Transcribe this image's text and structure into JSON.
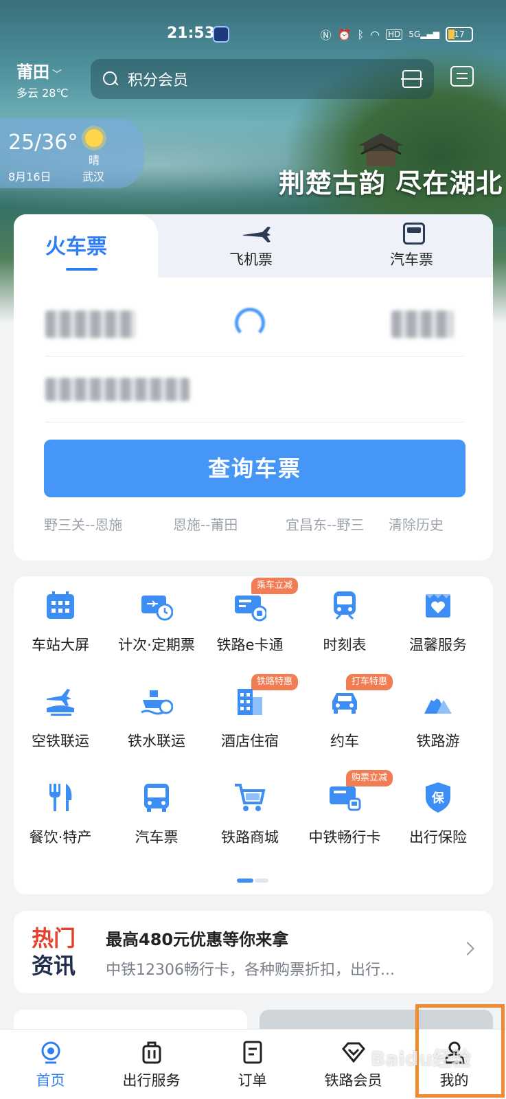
{
  "status_bar": {
    "time": "21:53",
    "hd_label": "HD",
    "signal_label": "5G",
    "battery_label": "17"
  },
  "header": {
    "city": "莆田",
    "weather": "多云 28℃",
    "search_placeholder": "积分会员"
  },
  "weather_card": {
    "temp_range": "25/36°",
    "condition": "晴",
    "date": "8月16日",
    "city": "武汉"
  },
  "banner": {
    "slogan": "荆楚古韵 尽在湖北"
  },
  "ticket_tabs": {
    "train": "火车票",
    "plane": "飞机票",
    "bus": "汽车票"
  },
  "search_button": "查询车票",
  "history": {
    "items": [
      "野三关--恩施",
      "恩施--莆田",
      "宜昌东--野三"
    ],
    "clear": "清除历史"
  },
  "services": {
    "items": [
      {
        "label": "车站大屏",
        "icon": "calendar-grid-icon",
        "tag": ""
      },
      {
        "label": "计次·定期票",
        "icon": "ticket-clock-icon",
        "tag": ""
      },
      {
        "label": "铁路e卡通",
        "icon": "card-icon",
        "tag": "乘车立减"
      },
      {
        "label": "时刻表",
        "icon": "train-front-icon",
        "tag": ""
      },
      {
        "label": "温馨服务",
        "icon": "heart-box-icon",
        "tag": ""
      },
      {
        "label": "空铁联运",
        "icon": "plane-train-icon",
        "tag": ""
      },
      {
        "label": "铁水联运",
        "icon": "ship-icon",
        "tag": ""
      },
      {
        "label": "酒店住宿",
        "icon": "hotel-icon",
        "tag": "铁路特惠"
      },
      {
        "label": "约车",
        "icon": "car-icon",
        "tag": "打车特惠"
      },
      {
        "label": "铁路游",
        "icon": "mountain-icon",
        "tag": ""
      },
      {
        "label": "餐饮·特产",
        "icon": "fork-knife-icon",
        "tag": ""
      },
      {
        "label": "汽车票",
        "icon": "bus-icon",
        "tag": ""
      },
      {
        "label": "铁路商城",
        "icon": "cart-icon",
        "tag": ""
      },
      {
        "label": "中铁畅行卡",
        "icon": "rail-card-icon",
        "tag": "购票立减"
      },
      {
        "label": "出行保险",
        "icon": "shield-icon",
        "tag": ""
      }
    ]
  },
  "news": {
    "badge_line1": "热门",
    "badge_line2": "资讯",
    "title": "最高480元优惠等你来拿",
    "subtitle": "中铁12306畅行卡，各种购票折扣，出行..."
  },
  "bottom_nav": {
    "items": [
      {
        "label": "首页",
        "icon": "home-icon"
      },
      {
        "label": "出行服务",
        "icon": "luggage-icon"
      },
      {
        "label": "订单",
        "icon": "order-icon"
      },
      {
        "label": "铁路会员",
        "icon": "diamond-icon"
      },
      {
        "label": "我的",
        "icon": "person-icon"
      }
    ]
  },
  "watermark": "Baidu经验",
  "colors": {
    "accent": "#2f7df2",
    "button": "#4596f6",
    "tag": "#f17d54",
    "highlight": "#f28b30"
  }
}
